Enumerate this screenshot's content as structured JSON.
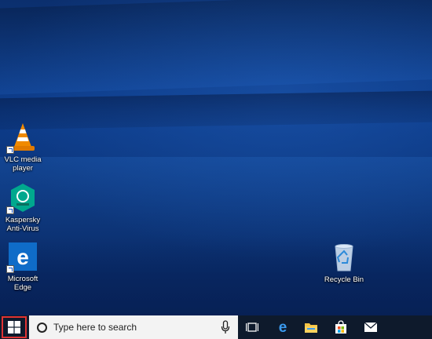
{
  "desktop": {
    "icons": [
      {
        "label_line1": "VLC media",
        "label_line2": "player",
        "icon": "vlc-cone-icon"
      },
      {
        "label_line1": "Kaspersky",
        "label_line2": "Anti-Virus",
        "icon": "kaspersky-icon"
      },
      {
        "label_line1": "Microsoft",
        "label_line2": "Edge",
        "icon": "edge-icon"
      },
      {
        "label_line1": "Recycle Bin",
        "label_line2": "",
        "icon": "recycle-bin-icon"
      }
    ]
  },
  "taskbar": {
    "start_icon": "windows-logo-icon",
    "search": {
      "placeholder": "Type here to search",
      "icon": "cortana-circle-icon",
      "mic_icon": "microphone-icon"
    },
    "buttons": [
      {
        "name": "task-view",
        "icon": "task-view-icon"
      },
      {
        "name": "edge",
        "icon": "edge-icon"
      },
      {
        "name": "file-explorer",
        "icon": "folder-icon"
      },
      {
        "name": "store",
        "icon": "store-bag-icon"
      },
      {
        "name": "mail",
        "icon": "mail-icon"
      }
    ]
  },
  "colors": {
    "desktop_bg": "#0d3d8c",
    "taskbar_bg": "#0e1a2c",
    "start_highlight": "#e03333",
    "edge_blue": "#0f6cc8",
    "kaspersky_green": "#00a88e",
    "vlc_orange": "#f08a00"
  }
}
